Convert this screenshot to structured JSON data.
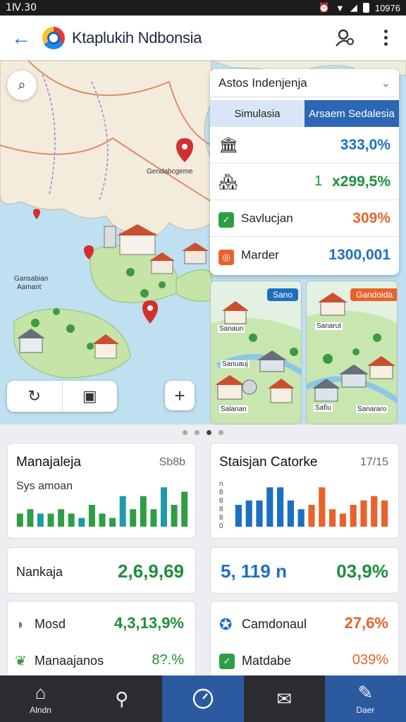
{
  "status": {
    "time": "1Ⅳ.30",
    "right": "10976"
  },
  "app": {
    "title": "Ktaplukih Ndbonsia"
  },
  "map": {
    "labels": [
      {
        "text": "Gendabcgeme"
      },
      {
        "text": "Gansabian"
      },
      {
        "text": "Aamant"
      }
    ]
  },
  "panel": {
    "dropdown": "Astos Indenjenja",
    "tabs": [
      "Simulasia",
      "Arsaem Sedalesia"
    ],
    "rows": [
      {
        "label": "",
        "value": "333,0%",
        "color": "#1d6fc2"
      },
      {
        "label": "1",
        "value": "x299,5%",
        "color": "#1e8f3a"
      },
      {
        "label": "Savlucjan",
        "value": "309%",
        "color": "#e8632c"
      },
      {
        "label": "Marder",
        "value": "1300,001",
        "color": "#1d6fc2"
      }
    ]
  },
  "thumbs": [
    {
      "chip": "Sano",
      "chip_color": "#1d6fc2",
      "labels": [
        "Sanaun",
        "Sanuauj",
        "Salanan"
      ]
    },
    {
      "chip": "Gandoida",
      "chip_color": "#e8632c",
      "labels": [
        "Sanarut",
        "Safiu",
        "Sanararo"
      ]
    }
  ],
  "cards": {
    "chart1": {
      "title": "Manajaleja",
      "meta": "Sb8b",
      "sub": "Sys amoan"
    },
    "chart2": {
      "title": "Staisjan Catorke",
      "meta": "17/15",
      "ticks": [
        "n",
        "8",
        "8",
        "8",
        "8",
        "0"
      ]
    },
    "stat1": {
      "label": "Nankaja",
      "value": "2,6,9,69"
    },
    "stat2": {
      "left": "5, 119 n",
      "right": "03,9%"
    },
    "list1": [
      {
        "label": "Mosd",
        "value": "4,3,13,9%"
      },
      {
        "label": "Manaajanos",
        "value": "8?.%"
      }
    ],
    "list2": [
      {
        "label": "Camdonaul",
        "value": "27,6%"
      },
      {
        "label": "Matdabe",
        "value": "039%"
      }
    ]
  },
  "chart_data": [
    {
      "type": "bar",
      "title": "Manajaleja",
      "values": [
        3,
        4,
        3,
        3,
        4,
        3,
        2,
        5,
        3,
        2,
        7,
        4,
        7,
        4,
        9,
        5,
        8
      ],
      "ylim": [
        0,
        10
      ]
    },
    {
      "type": "bar",
      "title": "Staisjan Catorke",
      "series": [
        {
          "values": [
            5,
            6,
            6,
            9,
            9,
            6,
            4
          ],
          "color": "#1d6fc2"
        },
        {
          "values": [
            5,
            9,
            4,
            3,
            5,
            6,
            7,
            6
          ],
          "color": "#e8632c"
        }
      ],
      "ylim": [
        0,
        10
      ]
    }
  ],
  "nav": [
    {
      "label": "Alndn",
      "icon": "home-icon"
    },
    {
      "label": "",
      "icon": "search-icon"
    },
    {
      "label": "",
      "icon": "gauge-icon"
    },
    {
      "label": "",
      "icon": "mail-icon"
    },
    {
      "label": "Daer",
      "icon": "edit-icon"
    }
  ]
}
